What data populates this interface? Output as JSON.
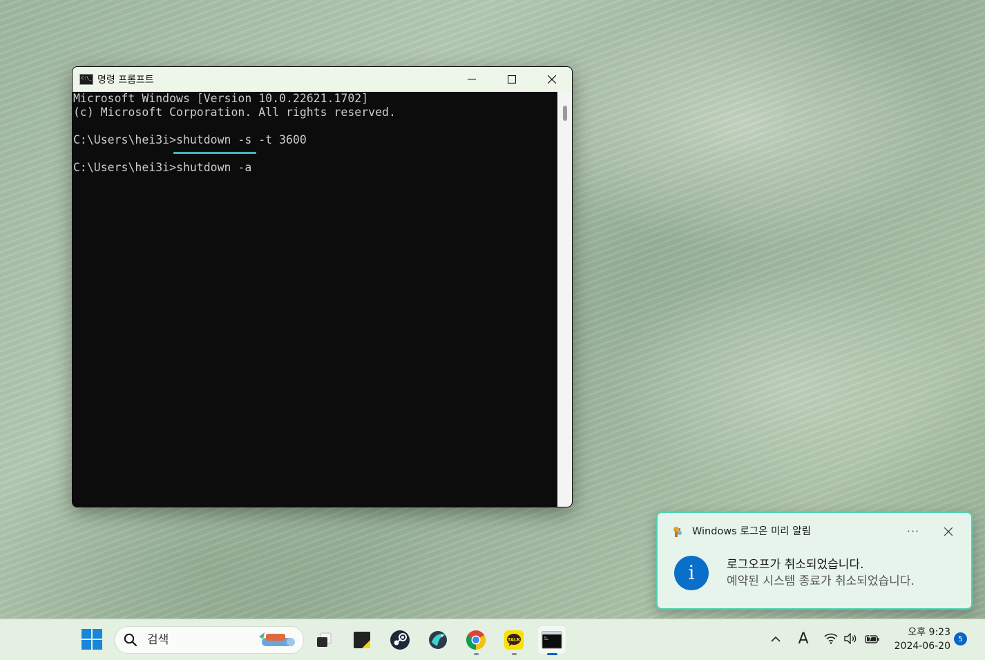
{
  "window": {
    "title": "명령 프롬프트",
    "icon": "cmd-icon",
    "lines": [
      "Microsoft Windows [Version 10.0.22621.1702]",
      "(c) Microsoft Corporation. All rights reserved.",
      "",
      "C:\\Users\\hei3i>shutdown -s -t 3600",
      "",
      "C:\\Users\\hei3i>shutdown -a"
    ],
    "highlight_color": "#3bb7c4"
  },
  "toast": {
    "app_name": "Windows 로그온 미리 알림",
    "more_label": "···",
    "title": "로그오프가 취소되었습니다.",
    "body": "예약된 시스템 종료가 취소되었습니다.",
    "accent": "#4fd3b3",
    "info_glyph": "i"
  },
  "taskbar": {
    "search_placeholder": "검색",
    "apps": [
      "task-view",
      "sticky-notes",
      "steam",
      "app-browser",
      "chrome",
      "kakaotalk",
      "command-prompt"
    ],
    "kakao_label": "TALK",
    "time": "오후 9:23",
    "date": "2024-06-20",
    "notification_count": "5",
    "ime_label": "A"
  }
}
